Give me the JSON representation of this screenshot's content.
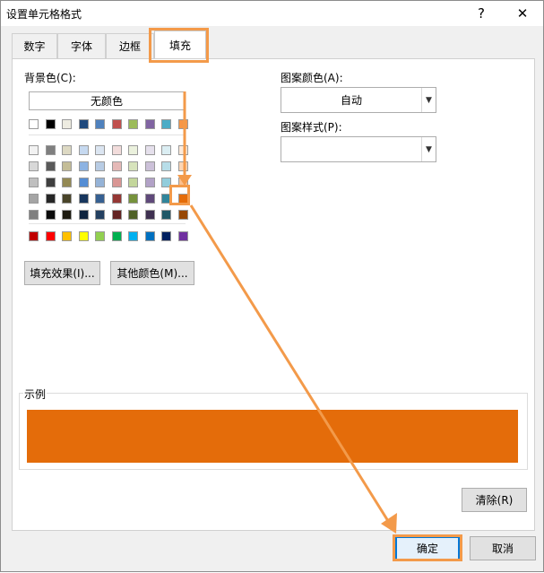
{
  "dialog": {
    "title": "设置单元格格式",
    "help": "?",
    "close": "✕"
  },
  "tabs": [
    {
      "label": "数字"
    },
    {
      "label": "字体"
    },
    {
      "label": "边框"
    },
    {
      "label": "填充",
      "active": true
    }
  ],
  "fill": {
    "background_label": "背景色(C):",
    "no_color_button": "无颜色",
    "fill_effects_button": "填充效果(I)...",
    "more_colors_button": "其他颜色(M)...",
    "selected_color": "#e46c0a",
    "palette": {
      "theme_top_row": [
        "#ffffff",
        "#000000",
        "#eeece1",
        "#1f497d",
        "#4f81bd",
        "#c0504d",
        "#9bbb59",
        "#8064a2",
        "#4bacc6",
        "#f79646"
      ],
      "theme_tints": [
        [
          "#f2f2f2",
          "#7f7f7f",
          "#ddd9c3",
          "#c6d9f0",
          "#dbe5f1",
          "#f2dcdb",
          "#ebf1dd",
          "#e5e0ec",
          "#dbeef3",
          "#fdeada"
        ],
        [
          "#d8d8d8",
          "#595959",
          "#c4bd97",
          "#8db3e2",
          "#b8cce4",
          "#e5b9b7",
          "#d7e3bc",
          "#ccc1d9",
          "#b7dde8",
          "#fbd5b5"
        ],
        [
          "#bfbfbf",
          "#3f3f3f",
          "#938953",
          "#548dd4",
          "#95b3d7",
          "#d99694",
          "#c3d69b",
          "#b2a2c7",
          "#92cddc",
          "#fac08f"
        ],
        [
          "#a5a5a5",
          "#262626",
          "#494429",
          "#17365d",
          "#366092",
          "#953734",
          "#76923c",
          "#5f497a",
          "#31859b",
          "#e46c0a"
        ],
        [
          "#7f7f7f",
          "#0c0c0c",
          "#1d1b10",
          "#0f243e",
          "#244061",
          "#632423",
          "#4f6128",
          "#3f3151",
          "#205867",
          "#974806"
        ]
      ],
      "standard": [
        "#c00000",
        "#ff0000",
        "#ffc000",
        "#ffff00",
        "#92d050",
        "#00b050",
        "#00b0f0",
        "#0070c0",
        "#002060",
        "#7030a0"
      ]
    },
    "pattern_color_label": "图案颜色(A):",
    "pattern_color_value": "自动",
    "pattern_style_label": "图案样式(P):",
    "pattern_style_value": ""
  },
  "sample": {
    "label": "示例",
    "color": "#e46c0a"
  },
  "buttons": {
    "clear": "清除(R)",
    "ok": "确定",
    "cancel": "取消"
  },
  "annotation_color": "#f39a4a"
}
